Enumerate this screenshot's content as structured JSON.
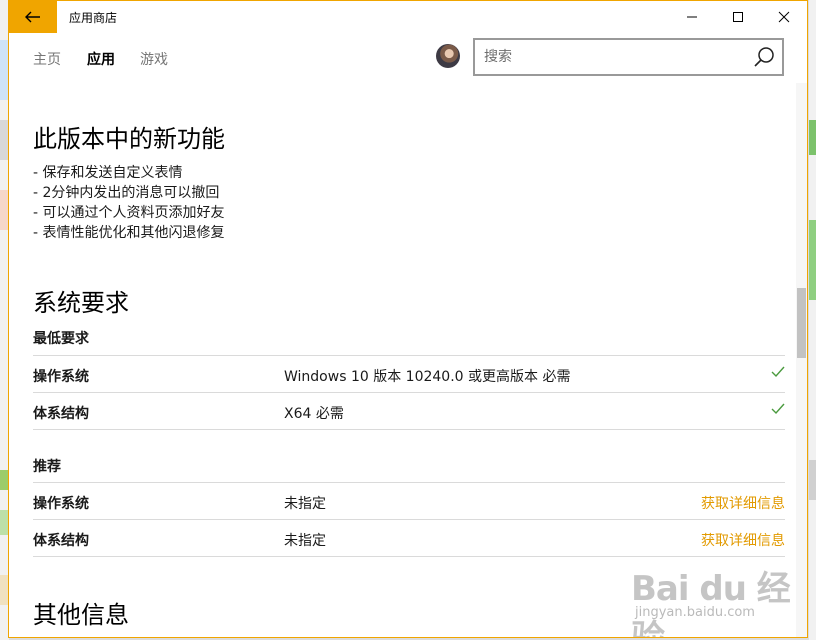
{
  "titlebar": {
    "app_title": "应用商店"
  },
  "nav": {
    "tabs": [
      {
        "label": "主页",
        "active": false
      },
      {
        "label": "应用",
        "active": true
      },
      {
        "label": "游戏",
        "active": false
      }
    ]
  },
  "search": {
    "placeholder": "搜索"
  },
  "whats_new": {
    "heading": "此版本中的新功能",
    "items": [
      "- 保存和发送自定义表情",
      "- 2分钟内发出的消息可以撤回",
      "- 可以通过个人资料页添加好友",
      "- 表情性能优化和其他闪退修复"
    ]
  },
  "system_requirements": {
    "heading": "系统要求",
    "minimum": {
      "title": "最低要求",
      "rows": [
        {
          "label": "操作系统",
          "value": "Windows 10 版本 10240.0 或更高版本 必需"
        },
        {
          "label": "体系结构",
          "value": "X64 必需"
        }
      ]
    },
    "recommended": {
      "title": "推荐",
      "rows": [
        {
          "label": "操作系统",
          "value": "未指定",
          "link": "获取详细信息"
        },
        {
          "label": "体系结构",
          "value": "未指定",
          "link": "获取详细信息"
        }
      ]
    }
  },
  "other_info": {
    "heading": "其他信息"
  },
  "watermark": {
    "brand": "Bai du 经验",
    "url": "jingyan.baidu.com"
  },
  "colors": {
    "accent": "#f0a500",
    "link": "#e29a00",
    "check": "#4a9a3e"
  }
}
